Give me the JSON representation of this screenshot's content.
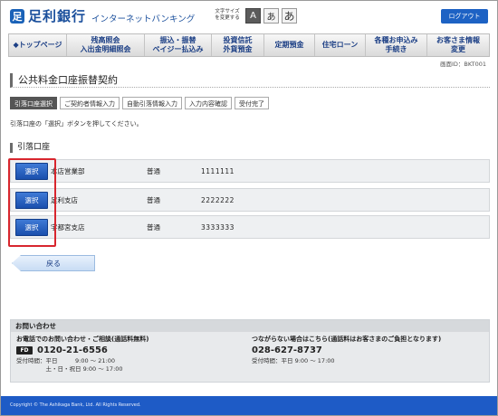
{
  "header": {
    "logo_mark": "足",
    "bank_name": "足利銀行",
    "service_name": "インターネットバンキング",
    "font_size_label": "文字サイズを変更する",
    "font_sizes": [
      "A",
      "あ",
      "あ"
    ],
    "logout_label": "ログアウト"
  },
  "nav": {
    "items": [
      {
        "label": "◆トップページ"
      },
      {
        "label": "残高照会\n入出金明細照会"
      },
      {
        "label": "振込・振替\nペイジー払込み"
      },
      {
        "label": "投資信託\n外貨預金"
      },
      {
        "label": "定期預金"
      },
      {
        "label": "住宅ローン"
      },
      {
        "label": "各種お申込み\n手続き"
      },
      {
        "label": "お客さま情報\n変更"
      }
    ]
  },
  "screen_id": "画面ID：BKT001",
  "page_title": "公共料金口座振替契約",
  "steps": [
    "引落口座選択",
    "ご契約者情報入力",
    "自動引落情報入力",
    "入力内容確認",
    "受付完了"
  ],
  "instruction": "引落口座の「選択」ボタンを押してください。",
  "section_title": "引落口座",
  "accounts": [
    {
      "select_label": "選択",
      "branch": "本店営業部",
      "type": "普通",
      "number": "1111111"
    },
    {
      "select_label": "選択",
      "branch": "足利支店",
      "type": "普通",
      "number": "2222222"
    },
    {
      "select_label": "選択",
      "branch": "宇都宮支店",
      "type": "普通",
      "number": "3333333"
    }
  ],
  "back_label": "戻る",
  "contact": {
    "heading": "お問い合わせ",
    "left_title": "お電話でのお問い合わせ・ご相談(通話料無料)",
    "left_badge": "FD",
    "left_phone": "0120-21-6556",
    "left_hours_1": "受付時間：平日　　　9:00 〜 21:00",
    "left_hours_2": "　　　　　土・日・祝日 9:00 〜 17:00",
    "right_title": "つながらない場合はこちら(通話料はお客さまのご負担となります)",
    "right_phone": "028-627-8737",
    "right_hours": "受付時間：平日 9:00 〜 17:00"
  },
  "footer": "Copyright © The Ashikaga Bank, Ltd. All Rights Reserved.",
  "colors": {
    "brand_blue": "#1e5bc6",
    "button_blue": "#1a4fad",
    "highlight_red": "#d8262e",
    "step_active": "#555555"
  }
}
